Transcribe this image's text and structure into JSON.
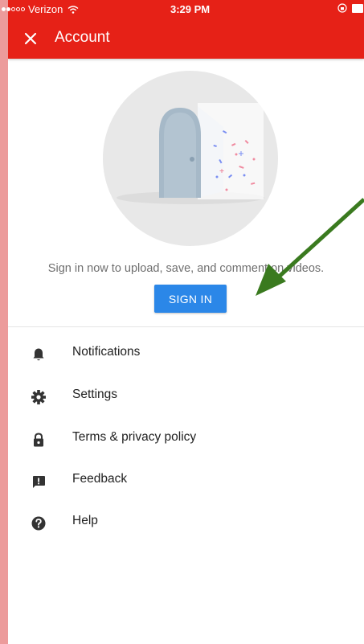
{
  "status_bar": {
    "carrier": "Verizon",
    "time": "3:29 PM",
    "signal_bars_filled": 2,
    "signal_bars_total": 5
  },
  "app_bar": {
    "title": "Account",
    "close_icon": "close-icon",
    "color": "#e62117"
  },
  "signin": {
    "prompt": "Sign in now to upload, save, and comment on videos.",
    "button_label": "SIGN IN",
    "button_color": "#2b87e8"
  },
  "menu": {
    "items": [
      {
        "label": "Notifications",
        "icon": "bell-icon"
      },
      {
        "label": "Settings",
        "icon": "gear-icon"
      },
      {
        "label": "Terms & privacy policy",
        "icon": "lock-icon"
      },
      {
        "label": "Feedback",
        "icon": "feedback-icon"
      },
      {
        "label": "Help",
        "icon": "help-icon"
      }
    ]
  },
  "annotation": {
    "arrow_color": "#3a7a1f"
  }
}
